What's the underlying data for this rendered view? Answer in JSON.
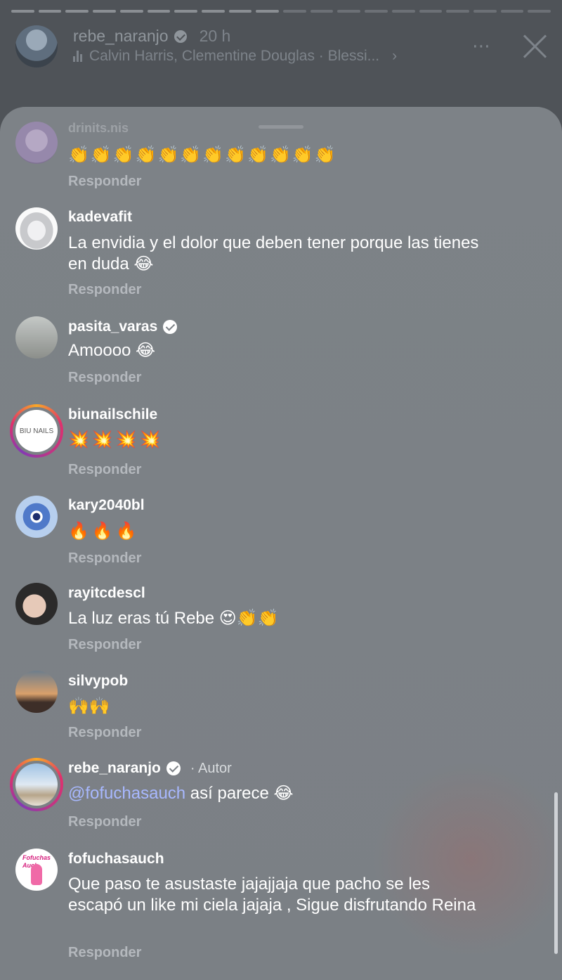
{
  "story": {
    "username": "rebe_naranjo",
    "time": "20 h",
    "music": "Calvin Harris, Clementine Douglas · Blessi...",
    "more_icon": "⋯",
    "progress_segments": 20,
    "progress_done": 10
  },
  "comments": [
    {
      "username": "drinits.nis",
      "text": "👏👏👏👏👏👏👏👏👏👏👏👏",
      "reply": "Responder"
    },
    {
      "username": "kadevafit",
      "text": "La envidia y el dolor que deben tener porque las tienes en duda 😂",
      "reply": "Responder"
    },
    {
      "username": "pasita_varas",
      "text": "Amoooo 😂",
      "reply": "Responder"
    },
    {
      "username": "biunailschile",
      "avatar_text": "BIU NAILS",
      "text": "💥💥💥💥",
      "reply": "Responder"
    },
    {
      "username": "kary2040bl",
      "text": "🔥🔥🔥",
      "reply": "Responder"
    },
    {
      "username": "rayitcdescl",
      "text": "La luz eras tú Rebe 😍👏👏",
      "reply": "Responder"
    },
    {
      "username": "silvypob",
      "text": "🙌🙌",
      "reply": "Responder"
    },
    {
      "username": "rebe_naranjo",
      "author_tag": "· Autor",
      "mention": "@fofuchasauch",
      "text": " así parece 😂",
      "reply": "Responder"
    },
    {
      "username": "fofuchasauch",
      "avatar_text": "Fofuchas Auch",
      "text": "Que paso te asustaste jajajjaja que pacho se les escapó un like mi ciela jajaja , Sigue disfrutando Reina",
      "reply": "Responder"
    }
  ]
}
